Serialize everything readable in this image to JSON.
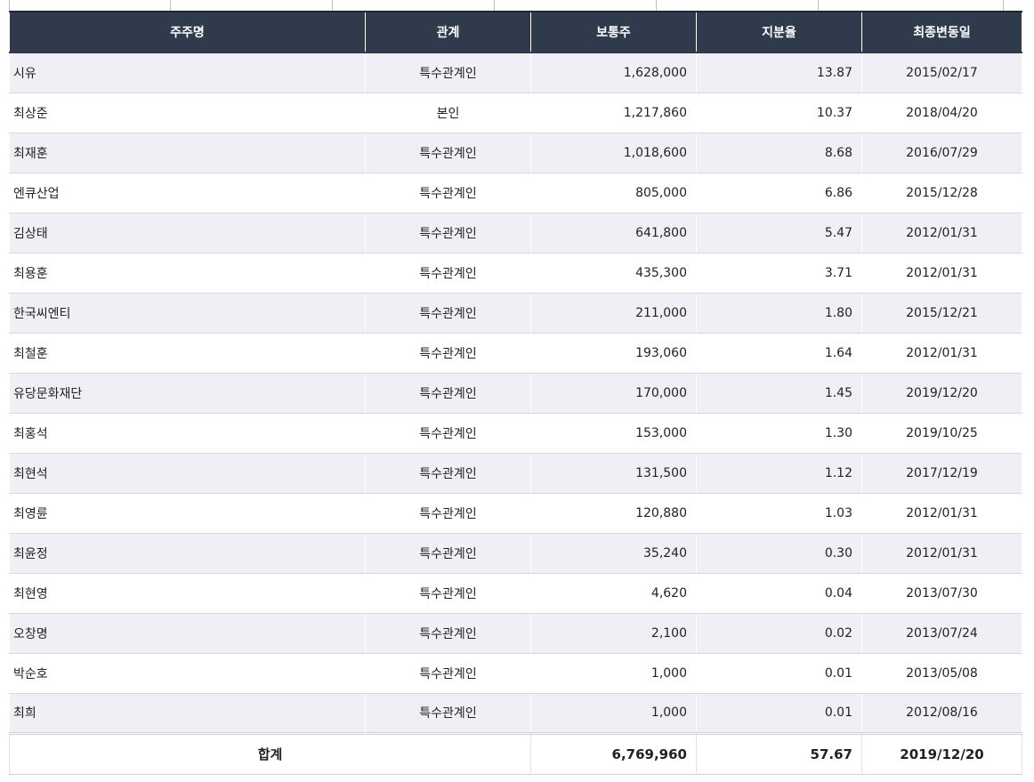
{
  "table": {
    "headers": [
      "주주명",
      "관계",
      "보통주",
      "지분율",
      "최종변동일"
    ],
    "rows": [
      {
        "name": "시유",
        "relation": "특수관계인",
        "shares": "1,628,000",
        "ratio": "13.87",
        "date": "2015/02/17"
      },
      {
        "name": "최상준",
        "relation": "본인",
        "shares": "1,217,860",
        "ratio": "10.37",
        "date": "2018/04/20"
      },
      {
        "name": "최재훈",
        "relation": "특수관계인",
        "shares": "1,018,600",
        "ratio": "8.68",
        "date": "2016/07/29"
      },
      {
        "name": "엔큐산업",
        "relation": "특수관계인",
        "shares": "805,000",
        "ratio": "6.86",
        "date": "2015/12/28"
      },
      {
        "name": "김상태",
        "relation": "특수관계인",
        "shares": "641,800",
        "ratio": "5.47",
        "date": "2012/01/31"
      },
      {
        "name": "최용훈",
        "relation": "특수관계인",
        "shares": "435,300",
        "ratio": "3.71",
        "date": "2012/01/31"
      },
      {
        "name": "한국씨엔티",
        "relation": "특수관계인",
        "shares": "211,000",
        "ratio": "1.80",
        "date": "2015/12/21"
      },
      {
        "name": "최철훈",
        "relation": "특수관계인",
        "shares": "193,060",
        "ratio": "1.64",
        "date": "2012/01/31"
      },
      {
        "name": "유당문화재단",
        "relation": "특수관계인",
        "shares": "170,000",
        "ratio": "1.45",
        "date": "2019/12/20"
      },
      {
        "name": "최홍석",
        "relation": "특수관계인",
        "shares": "153,000",
        "ratio": "1.30",
        "date": "2019/10/25"
      },
      {
        "name": "최현석",
        "relation": "특수관계인",
        "shares": "131,500",
        "ratio": "1.12",
        "date": "2017/12/19"
      },
      {
        "name": "최영륜",
        "relation": "특수관계인",
        "shares": "120,880",
        "ratio": "1.03",
        "date": "2012/01/31"
      },
      {
        "name": "최윤정",
        "relation": "특수관계인",
        "shares": "35,240",
        "ratio": "0.30",
        "date": "2012/01/31"
      },
      {
        "name": "최현영",
        "relation": "특수관계인",
        "shares": "4,620",
        "ratio": "0.04",
        "date": "2013/07/30"
      },
      {
        "name": "오창명",
        "relation": "특수관계인",
        "shares": "2,100",
        "ratio": "0.02",
        "date": "2013/07/24"
      },
      {
        "name": "박순호",
        "relation": "특수관계인",
        "shares": "1,000",
        "ratio": "0.01",
        "date": "2013/05/08"
      },
      {
        "name": "최희",
        "relation": "특수관계인",
        "shares": "1,000",
        "ratio": "0.01",
        "date": "2012/08/16"
      }
    ],
    "total": {
      "label": "합계",
      "shares": "6,769,960",
      "ratio": "57.67",
      "date": "2019/12/20"
    }
  },
  "colors": {
    "header_bg": "#2f3b4c",
    "row_alt_bg": "#eef0f5"
  }
}
